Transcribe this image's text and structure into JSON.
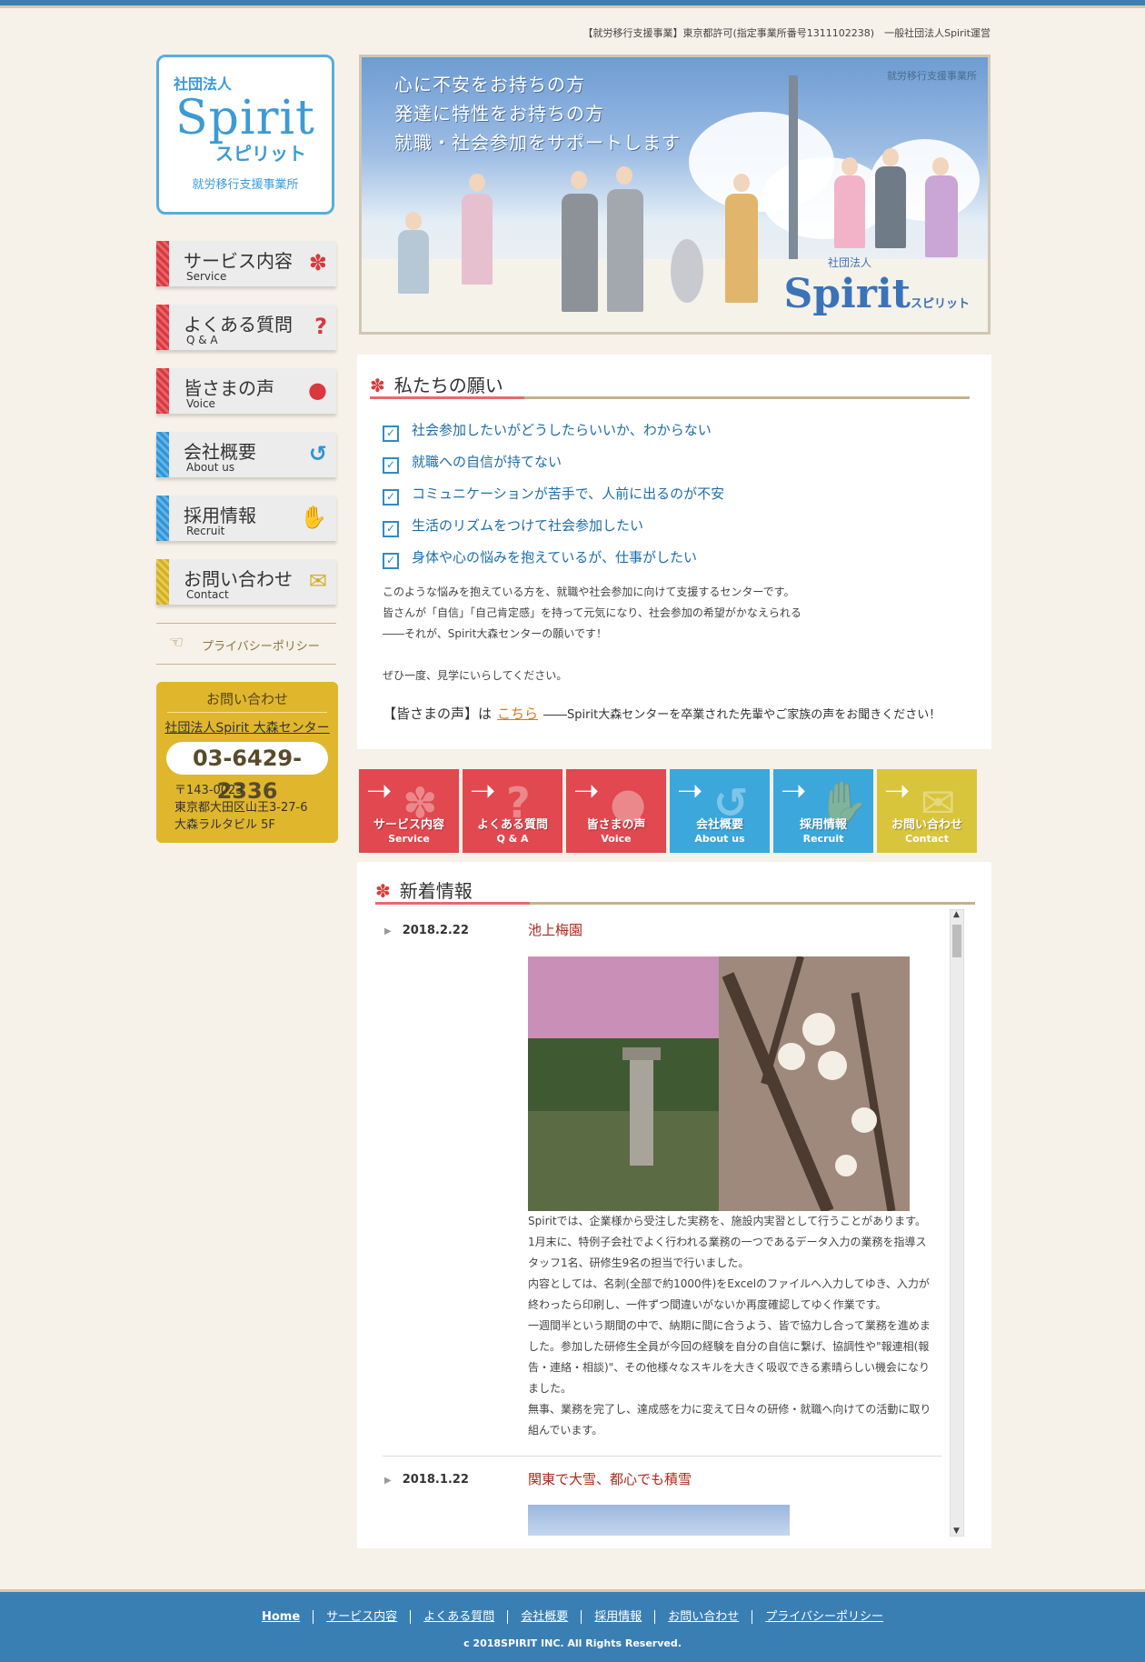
{
  "header_note": "【就労移行支援事業】東京都許可(指定事業所番号1311102238)　一般社団法人Spirit運営",
  "logo": {
    "top": "社団法人",
    "main": "Spirit",
    "kana": "スピリット",
    "sub": "就労移行支援事業所"
  },
  "menu": [
    {
      "jp": "サービス内容",
      "en": "Service",
      "icon": "✽",
      "color": "#d9383f"
    },
    {
      "jp": "よくある質問",
      "en": "Q & A",
      "icon": "?",
      "color": "#d9383f"
    },
    {
      "jp": "皆さまの声",
      "en": "Voice",
      "icon": "●",
      "color": "#d9383f"
    },
    {
      "jp": "会社概要",
      "en": "About us",
      "icon": "↺",
      "color": "#2f95d6"
    },
    {
      "jp": "採用情報",
      "en": "Recruit",
      "icon": "✋",
      "color": "#2f95d6"
    },
    {
      "jp": "お問い合わせ",
      "en": "Contact",
      "icon": "✉",
      "color": "#d1b021"
    }
  ],
  "privacy": "プライバシーポリシー",
  "contact": {
    "title": "お問い合わせ",
    "name": "社団法人Spirit 大森センター",
    "phone": "03-6429-2336",
    "zip": "〒143-0023",
    "addr1": "東京都大田区山王3-27-6",
    "addr2": "大森ラルタビル 5F"
  },
  "hero": {
    "line1": "心に不安をお持ちの方",
    "line2": "発達に特性をお持ちの方",
    "line3": "就職・社会参加をサポートします",
    "tag": "就労移行支援事業所",
    "brand_top": "社団法人",
    "brand": "Spirit",
    "brand_kana": "スピリット"
  },
  "wishes": {
    "heading": "私たちの願い",
    "items": [
      "社会参加したいがどうしたらいいか、わからない",
      "就職への自信が持てない",
      "コミュニケーションが苦手で、人前に出るのが不安",
      "生活のリズムをつけて社会参加したい",
      "身体や心の悩みを抱えているが、仕事がしたい"
    ],
    "para1": "このような悩みを抱えている方を、就職や社会参加に向けて支援するセンターです。",
    "para2": "皆さんが「自信」「自己肯定感」を持って元気になり、社会参加の希望がかなえられる",
    "para3": "――それが、Spirit大森センターの願いです！",
    "para4": "ぜひ一度、見学にいらしてください。",
    "voice_label": "【皆さまの声】は",
    "voice_link": "こちら",
    "voice_tail": "――Spirit大森センターを卒業された先輩やご家族の声をお聞きください！"
  },
  "tiles": [
    {
      "jp": "サービス内容",
      "en": "Service",
      "icon": "✽"
    },
    {
      "jp": "よくある質問",
      "en": "Q & A",
      "icon": "?"
    },
    {
      "jp": "皆さまの声",
      "en": "Voice",
      "icon": "●"
    },
    {
      "jp": "会社概要",
      "en": "About us",
      "icon": "↺"
    },
    {
      "jp": "採用情報",
      "en": "Recruit",
      "icon": "✋"
    },
    {
      "jp": "お問い合わせ",
      "en": "Contact",
      "icon": "✉"
    }
  ],
  "news": {
    "heading": "新着情報",
    "item1": {
      "date": "2018.2.22",
      "title": "池上梅園",
      "lines": [
        "Spiritでは、企業様から受注した実務を、施設内実習として行うことがあります。",
        "1月末に、特例子会社でよく行われる業務の一つであるデータ入力の業務を指導スタッフ1名、研修生9名の担当で行いました。",
        "内容としては、名刺(全部で約1000件)をExcelのファイルへ入力してゆき、入力が終わったら印刷し、一件ずつ間違いがないか再度確認してゆく作業です。",
        "一週間半という期間の中で、納期に間に合うよう、皆で協力し合って業務を進めました。参加した研修生全員が今回の経験を自分の自信に繋げ、協調性や\"報連相(報告・連絡・相談)\"、その他様々なスキルを大きく吸収できる素晴らしい機会になりました。",
        "無事、業務を完了し、達成感を力に変えて日々の研修・就職へ向けての活動に取り組んでいます。"
      ]
    },
    "item2": {
      "date": "2018.1.22",
      "title": "関東で大雪、都心でも積雪"
    }
  },
  "footer": {
    "links": [
      "Home",
      "サービス内容",
      "よくある質問",
      "会社概要",
      "採用情報",
      "お問い合わせ",
      "プライバシーポリシー"
    ],
    "copyright": "c 2018SPIRIT INC. All Rights Reserved."
  }
}
